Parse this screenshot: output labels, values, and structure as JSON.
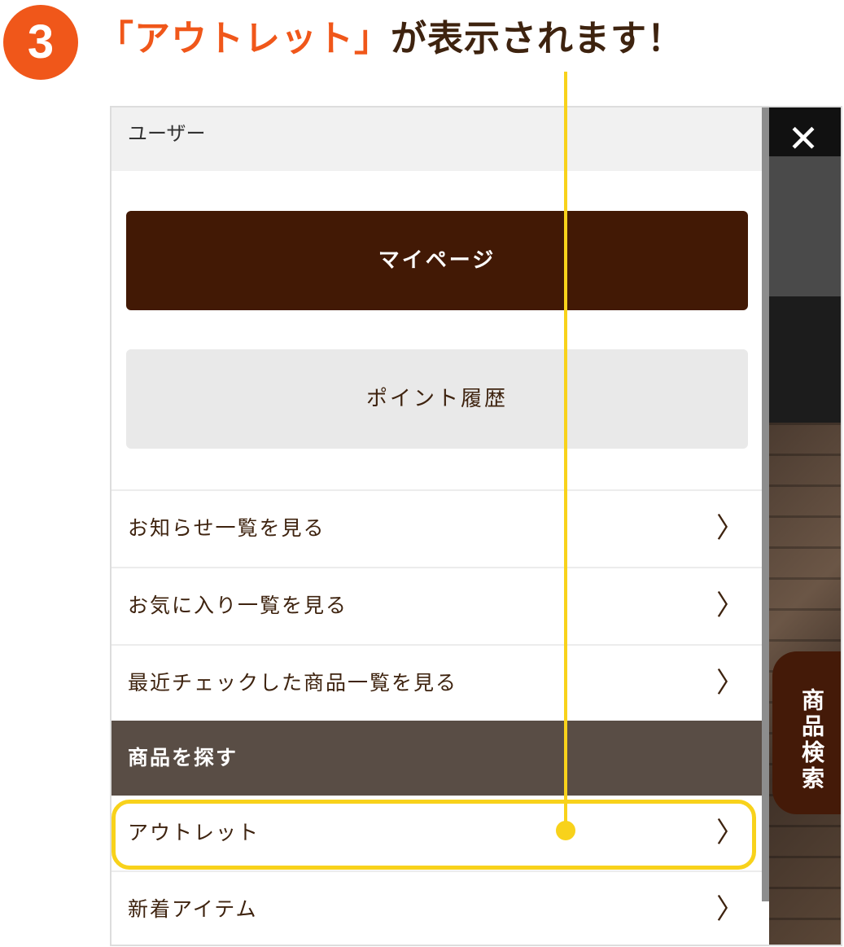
{
  "step": {
    "number": "3"
  },
  "headline": {
    "accent": "「アウトレット」",
    "rest": "が表示されます！"
  },
  "menu": {
    "user_section_label": "ユーザー",
    "mypage_label": "マイページ",
    "points_label": "ポイント履歴",
    "links": [
      {
        "label": "お知らせ一覧を見る"
      },
      {
        "label": "お気に入り一覧を見る"
      },
      {
        "label": "最近チェックした商品一覧を見る"
      }
    ],
    "find_section_label": "商品を探す",
    "find_links": [
      {
        "label": "アウトレット"
      },
      {
        "label": "新着アイテム"
      }
    ],
    "chevron": "〉"
  },
  "overlay": {
    "close_symbol": "✕",
    "search_tab_label": "商品検索"
  },
  "colors": {
    "accent_orange": "#f0571a",
    "brown_dark": "#421905",
    "section_brown": "#594d45",
    "highlight_yellow": "#f8d21b"
  }
}
